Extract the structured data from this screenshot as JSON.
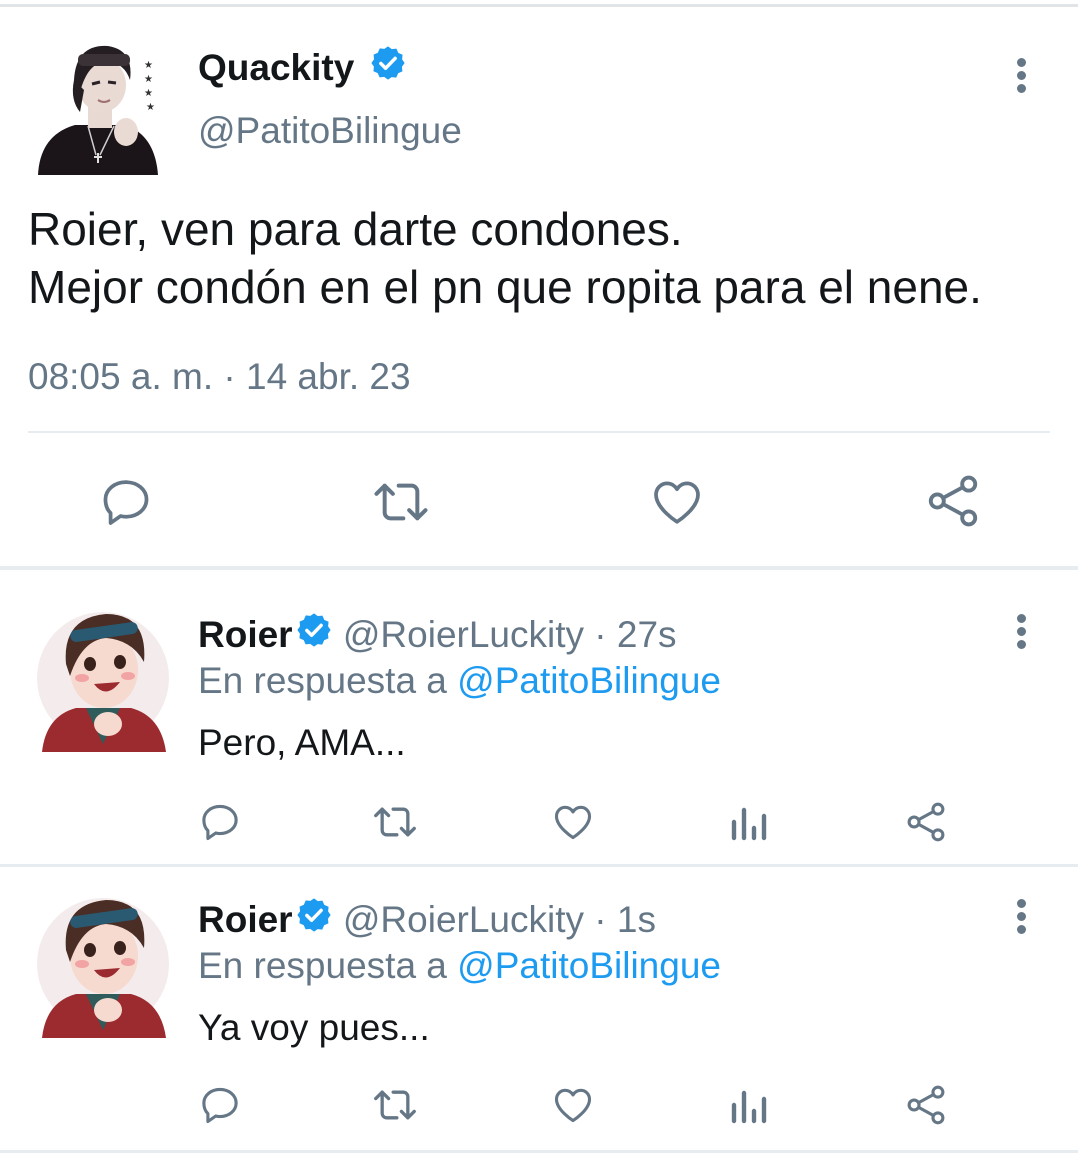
{
  "main_tweet": {
    "name": "Quackity",
    "handle": "@PatitoBilingue",
    "text_lines": [
      "Roier, ven para darte condones.",
      "Mejor condón en el pn que ropita para el nene."
    ],
    "time": "08:05 a. m.",
    "separator": "·",
    "date": "14 abr. 23"
  },
  "replies": [
    {
      "name": "Roier",
      "handle": "@RoierLuckity",
      "separator": "·",
      "time": "27s",
      "reply_prefix": "En respuesta a",
      "reply_to": "@PatitoBilingue",
      "text": "Pero, AMA..."
    },
    {
      "name": "Roier",
      "handle": "@RoierLuckity",
      "separator": "·",
      "time": "1s",
      "reply_prefix": "En respuesta a",
      "reply_to": "@PatitoBilingue",
      "text": "Ya voy pues..."
    }
  ],
  "icons": {
    "verified": "verified-badge-icon",
    "more": "more-vertical-icon",
    "reply": "reply-icon",
    "retweet": "retweet-icon",
    "like": "heart-icon",
    "analytics": "analytics-icon",
    "share": "share-icon"
  },
  "colors": {
    "verified_blue": "#1d9bf0",
    "icon_gray": "#657786",
    "link_blue": "#1d9bf0",
    "text": "#14171a"
  }
}
